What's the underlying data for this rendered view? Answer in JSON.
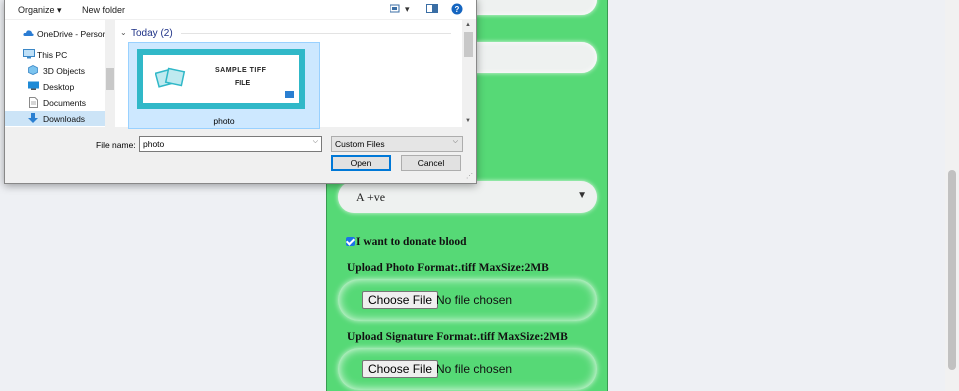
{
  "dialog": {
    "toolbar": {
      "organize": "Organize ▾",
      "new_folder": "New folder"
    },
    "nav": [
      {
        "label": "OneDrive - Person",
        "icon": "cloud-icon",
        "color": "#2b7cd3"
      },
      {
        "label": "This PC",
        "icon": "computer-icon",
        "color": "#3b87c6"
      },
      {
        "label": "3D Objects",
        "icon": "cube-icon",
        "color": "#5fb3e6"
      },
      {
        "label": "Desktop",
        "icon": "desktop-icon",
        "color": "#1e8ad6"
      },
      {
        "label": "Documents",
        "icon": "document-icon",
        "color": "#8a8a8a"
      },
      {
        "label": "Downloads",
        "icon": "download-icon",
        "color": "#2a7fd1"
      }
    ],
    "group_header": "Today (2)",
    "file": {
      "name": "photo",
      "thumb_line1": "SAMPLE TIFF",
      "thumb_line2": "FILE"
    },
    "file_name_label": "File name:",
    "file_name_value": "photo",
    "file_type": "Custom Files",
    "open_label": "Open",
    "cancel_label": "Cancel"
  },
  "form": {
    "blood_group": "A +ve",
    "donate_label": "I want to donate blood",
    "donate_checked": true,
    "photo_label": "Upload Photo Format:.tiff MaxSize:2MB",
    "signature_label": "Upload Signature Format:.tiff MaxSize:2MB",
    "choose_file": "Choose File",
    "no_file": "No file chosen"
  },
  "colors": {
    "form_bg": "#56d976",
    "accent": "#0078d7",
    "page_bg": "#eef0f4"
  }
}
